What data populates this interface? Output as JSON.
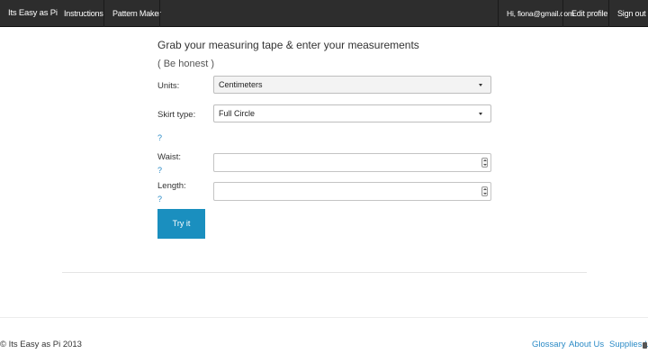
{
  "navbar": {
    "brand": "Its Easy as Pi",
    "instructions": "Instructions",
    "pattern_maker": "Pattern Maker",
    "user_greeting": "Hi, fiona@gmail.com",
    "edit_profile": "Edit profile",
    "sign_out": "Sign out"
  },
  "form": {
    "heading": "Grab your measuring tape & enter your measurements",
    "subheading": "( Be honest )",
    "units_label": "Units:",
    "units_value": "Centimeters",
    "skirt_type_label": "Skirt type:",
    "skirt_type_value": "Full Circle",
    "skirt_help": "?",
    "waist_label": "Waist:",
    "waist_help": "?",
    "waist_value": "",
    "length_label": "Length:",
    "length_help": "?",
    "length_value": "",
    "submit_label": "Try it"
  },
  "footer": {
    "copyright": "© Its Easy as Pi 2013",
    "glossary": "Glossary",
    "about": "About Us",
    "supplies": "Supplies List"
  },
  "colors": {
    "navbar_bg": "#2d2d2d",
    "accent": "#1a8fbf",
    "link": "#2a8ac6"
  },
  "icons": {
    "select_caret": "caret-down-icon",
    "number_spinner": "spinner-icon"
  }
}
